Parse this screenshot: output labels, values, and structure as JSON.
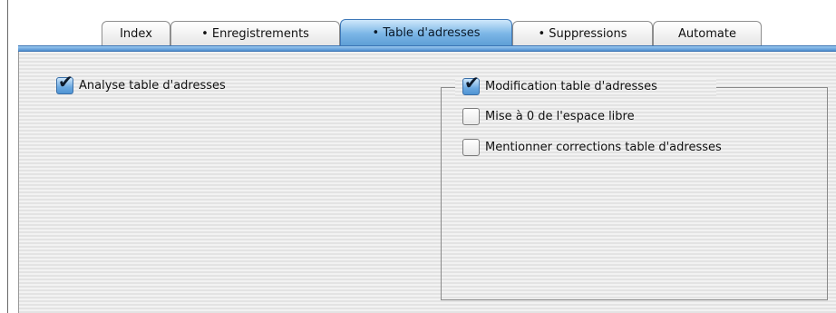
{
  "tabs": [
    {
      "label": "Index",
      "selected": false
    },
    {
      "label": "• Enregistrements",
      "selected": false
    },
    {
      "label": "• Table d'adresses",
      "selected": true
    },
    {
      "label": "• Suppressions",
      "selected": false
    },
    {
      "label": "Automate",
      "selected": false
    }
  ],
  "options": {
    "analyse": {
      "label": "Analyse table d'adresses",
      "checked": true
    },
    "modification": {
      "label": "Modification table d'adresses",
      "checked": true
    },
    "mise_a_zero": {
      "label": "Mise à 0 de l'espace libre",
      "checked": false
    },
    "mentionner": {
      "label": "Mentionner corrections table d'adresses",
      "checked": false
    }
  },
  "icons": {
    "checkmark": "check-icon"
  },
  "colors": {
    "accent": "#5f9fd6",
    "accent_border": "#3e78b8"
  }
}
